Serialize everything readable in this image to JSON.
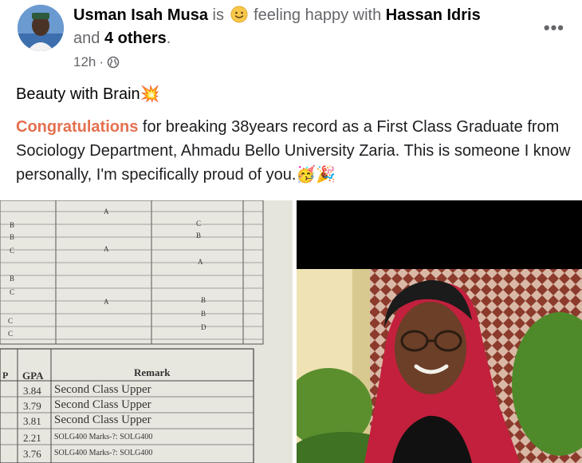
{
  "post": {
    "author": "Usman Isah Musa",
    "is_text": "is",
    "feeling_text": "feeling happy with",
    "tagged_person": "Hassan Idris",
    "and_text": "and",
    "others": "4 others",
    "period": ".",
    "time": "12h",
    "dot": "·",
    "more_label": "•••",
    "line1": "Beauty with Brain💥",
    "congrats_word": "Congratulations",
    "body_text": " for breaking 38years record as a First Class Graduate from Sociology Department, Ahmadu Bello University Zaria. This is someone I know personally, I'm specifically proud of you.🥳🎉"
  },
  "transcript": {
    "grades_top": [
      {
        "col1": "B",
        "col2": "A",
        "col3": ""
      },
      {
        "col1": "B",
        "col2": "",
        "col3": "C"
      },
      {
        "col1": "B",
        "col2": "",
        "col3": "B"
      },
      {
        "col1": "C",
        "col2": "A",
        "col3": ""
      },
      {
        "col1": "",
        "col2": "",
        "col3": "A"
      },
      {
        "col1": "B",
        "col2": "",
        "col3": ""
      },
      {
        "col1": "C",
        "col2": "",
        "col3": ""
      },
      {
        "col1": "",
        "col2": "A",
        "col3": "B"
      },
      {
        "col1": "",
        "col2": "",
        "col3": "B"
      },
      {
        "col1": "C",
        "col2": "",
        "col3": "D"
      },
      {
        "col1": "C",
        "col2": "",
        "col3": ""
      }
    ],
    "header_p": "P",
    "header_gpa": "GPA",
    "header_remark": "Remark",
    "rows": [
      {
        "gpa": "3.84",
        "remark": "Second Class Upper"
      },
      {
        "gpa": "3.79",
        "remark": "Second Class Upper"
      },
      {
        "gpa": "3.81",
        "remark": "Second Class Upper"
      },
      {
        "gpa": "2.21",
        "remark": "SOLG400 Marks-?: SOLG400"
      },
      {
        "gpa": "3.76",
        "remark": "SOLG400 Marks-?: SOLG400"
      }
    ]
  }
}
